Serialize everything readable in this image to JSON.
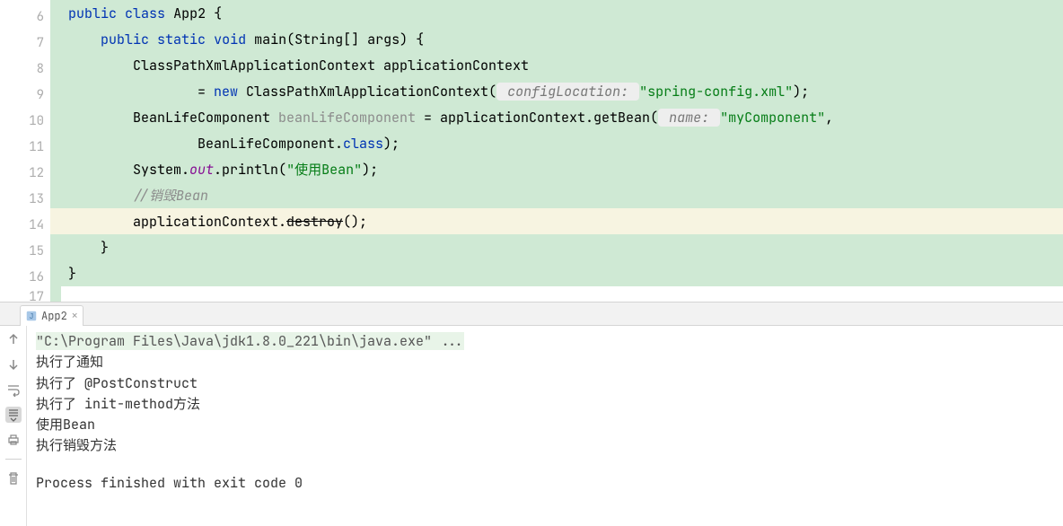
{
  "gutter": {
    "lines": [
      "6",
      "7",
      "8",
      "9",
      "10",
      "11",
      "12",
      "13",
      "14",
      "15",
      "16",
      "17"
    ],
    "runMarkers": [
      0,
      1
    ]
  },
  "code": {
    "l6": {
      "kw1": "public",
      "kw2": "class",
      "cls": "App2",
      "brace": " {"
    },
    "l7": {
      "indent": "    ",
      "kw1": "public",
      "kw2": "static",
      "kw3": "void",
      "mth": "main",
      "sig": "(String[] args) {"
    },
    "l8": {
      "indent": "        ",
      "text1": "ClassPathXmlApplicationContext applicationContext"
    },
    "l9": {
      "indent": "                ",
      "eq": "= ",
      "kw": "new",
      "cls": " ClassPathXmlApplicationContext(",
      "hint": " configLocation: ",
      "str": "\"spring-config.xml\"",
      "end": ");"
    },
    "l10": {
      "indent": "        ",
      "cls": "BeanLifeComponent ",
      "gray": "beanLifeComponent",
      "eq": " = applicationContext.getBean(",
      "hint": " name: ",
      "str": "\"myComponent\"",
      "end": ","
    },
    "l11": {
      "indent": "                ",
      "cls": "BeanLifeComponent.",
      "kw": "class",
      "end": ");"
    },
    "l12": {
      "indent": "        ",
      "sys": "System.",
      "out": "out",
      "prn": ".println(",
      "str": "\"使用Bean\"",
      "end": ");"
    },
    "l13": {
      "indent": "        ",
      "cmt": "//销毁Bean"
    },
    "l14": {
      "indent": "        ",
      "ctx": "applicationContext.",
      "strike": "destroy",
      "end": "();"
    },
    "l15": {
      "indent": "    ",
      "brace": "}"
    },
    "l16": {
      "indent": "",
      "brace": "}"
    }
  },
  "tab": {
    "label": "App2"
  },
  "console": {
    "cmd": "\"C:\\Program Files\\Java\\jdk1.8.0_221\\bin\\java.exe\" ...",
    "out": [
      "执行了通知",
      "执行了 @PostConstruct",
      "执行了 init-method方法",
      "使用Bean",
      "执行销毁方法"
    ],
    "exit": "Process finished with exit code 0"
  },
  "toolbar": {
    "up": "↑",
    "down": "↓"
  }
}
